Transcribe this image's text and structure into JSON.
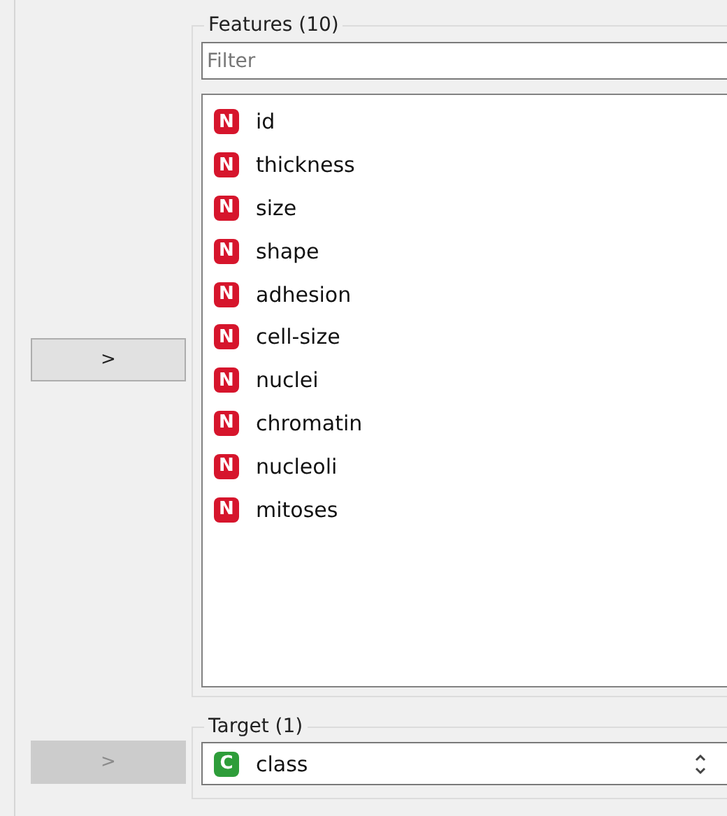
{
  "move_buttons": [
    {
      "label": ">",
      "disabled": false
    },
    {
      "label": ">",
      "disabled": true
    }
  ],
  "features": {
    "title": "Features (10)",
    "filter": {
      "placeholder": "Filter"
    },
    "items": [
      {
        "badge": "N",
        "kind": "numeric",
        "name": "id"
      },
      {
        "badge": "N",
        "kind": "numeric",
        "name": "thickness"
      },
      {
        "badge": "N",
        "kind": "numeric",
        "name": "size"
      },
      {
        "badge": "N",
        "kind": "numeric",
        "name": "shape"
      },
      {
        "badge": "N",
        "kind": "numeric",
        "name": "adhesion"
      },
      {
        "badge": "N",
        "kind": "numeric",
        "name": "cell-size"
      },
      {
        "badge": "N",
        "kind": "numeric",
        "name": "nuclei"
      },
      {
        "badge": "N",
        "kind": "numeric",
        "name": "chromatin"
      },
      {
        "badge": "N",
        "kind": "numeric",
        "name": "nucleoli"
      },
      {
        "badge": "N",
        "kind": "numeric",
        "name": "mitoses"
      }
    ]
  },
  "target": {
    "title": "Target (1)",
    "value": {
      "badge": "C",
      "kind": "categorical",
      "name": "class"
    }
  }
}
